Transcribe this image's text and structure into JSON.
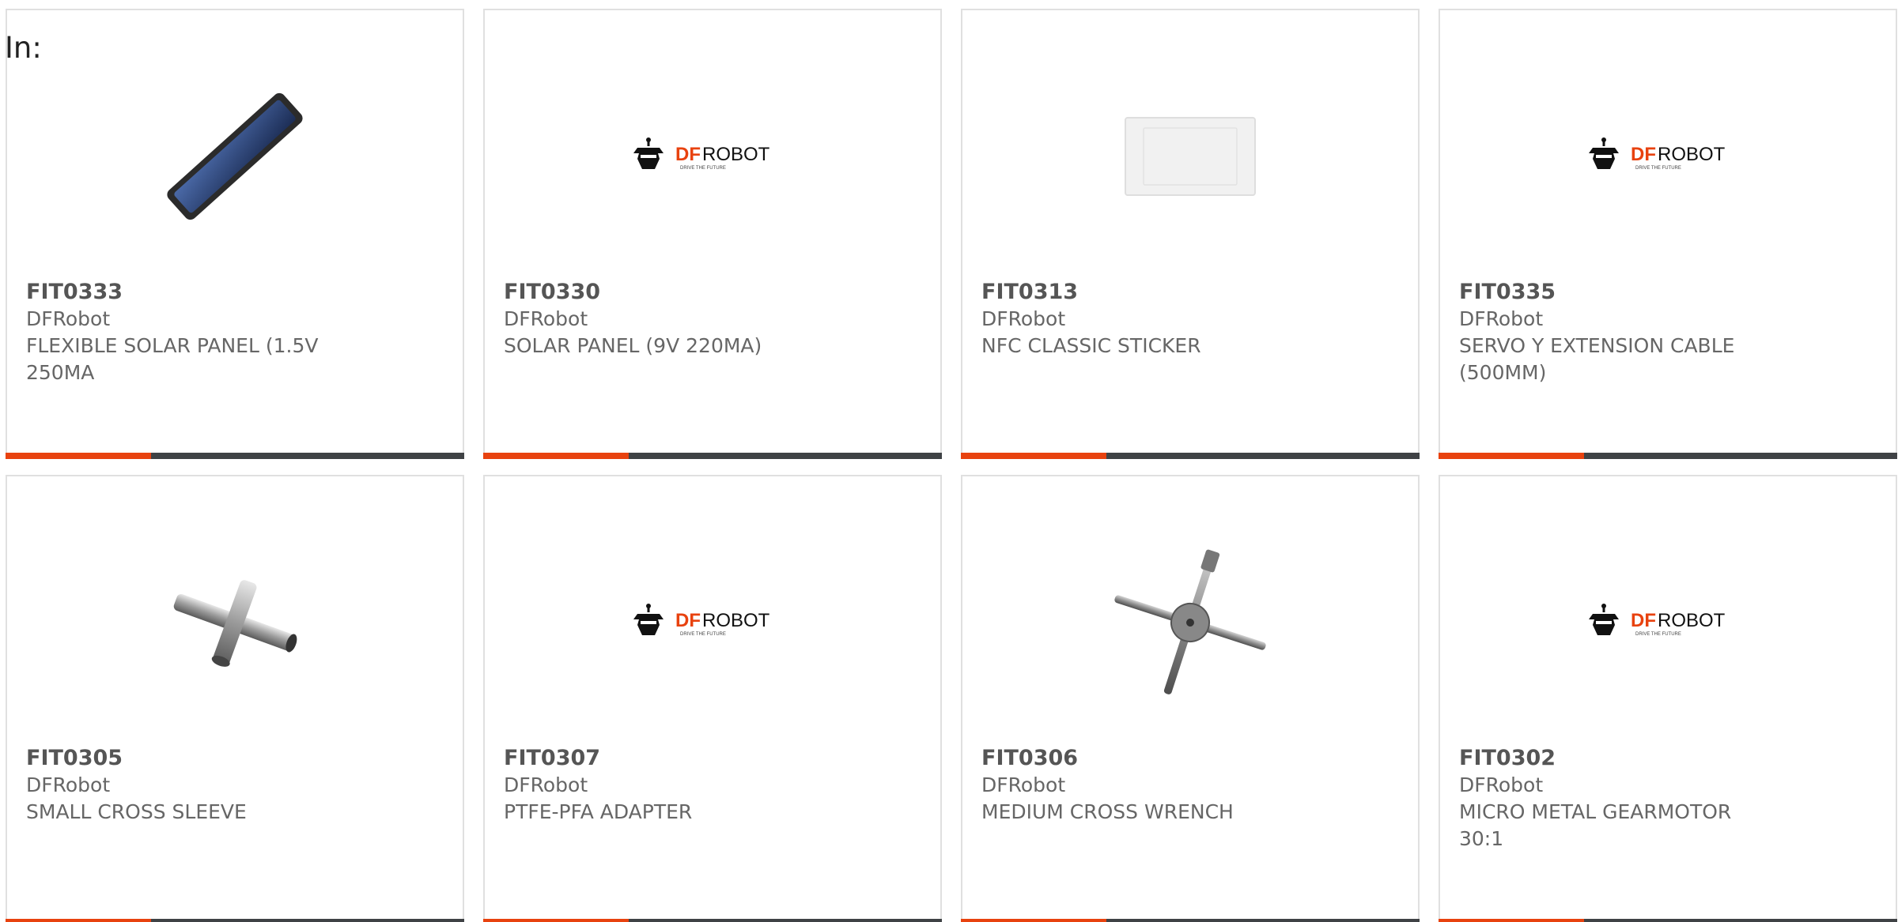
{
  "filter_label": "In:",
  "colors": {
    "accent": "#e8420f",
    "bar_dark": "#3f4245",
    "card_border": "#e0e0e0",
    "text_gray": "#666666"
  },
  "logo": {
    "brand_left": "DF",
    "brand_right": "ROBOT",
    "tagline": "DRIVE THE FUTURE"
  },
  "products": [
    {
      "sku": "FIT0333",
      "brand": "DFRobot",
      "name": "FLEXIBLE SOLAR PANEL (1.5V 250MA",
      "image": "solar-panel-strip"
    },
    {
      "sku": "FIT0330",
      "brand": "DFRobot",
      "name": "SOLAR PANEL (9V 220MA)",
      "image": "dfrobot-logo"
    },
    {
      "sku": "FIT0313",
      "brand": "DFRobot",
      "name": "NFC CLASSIC STICKER",
      "image": "nfc-sticker"
    },
    {
      "sku": "FIT0335",
      "brand": "DFRobot",
      "name": "SERVO Y EXTENSION CABLE (500MM)",
      "image": "dfrobot-logo"
    },
    {
      "sku": "FIT0305",
      "brand": "DFRobot",
      "name": "SMALL CROSS SLEEVE",
      "image": "cross-sleeve"
    },
    {
      "sku": "FIT0307",
      "brand": "DFRobot",
      "name": "PTFE-PFA ADAPTER",
      "image": "dfrobot-logo"
    },
    {
      "sku": "FIT0306",
      "brand": "DFRobot",
      "name": "MEDIUM CROSS WRENCH",
      "image": "cross-wrench"
    },
    {
      "sku": "FIT0302",
      "brand": "DFRobot",
      "name": "MICRO METAL GEARMOTOR 30:1",
      "image": "dfrobot-logo"
    }
  ]
}
